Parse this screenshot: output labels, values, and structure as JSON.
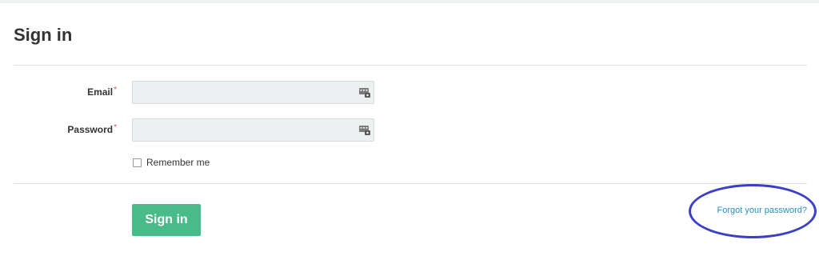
{
  "page": {
    "title": "Sign in"
  },
  "form": {
    "email": {
      "label": "Email",
      "required_mark": "*",
      "value": "",
      "placeholder": ""
    },
    "password": {
      "label": "Password",
      "required_mark": "*",
      "value": "",
      "placeholder": ""
    },
    "remember": {
      "label": "Remember me",
      "checked": false
    },
    "submit_label": "Sign in",
    "forgot_label": "Forgot your password?"
  },
  "icons": {
    "autofill": "password-manager-icon",
    "annotation": "highlight-circle"
  },
  "colors": {
    "button": "#48bb88",
    "link": "#2a8fc1",
    "required": "#d9534f",
    "annotation": "#3a3fc8"
  }
}
